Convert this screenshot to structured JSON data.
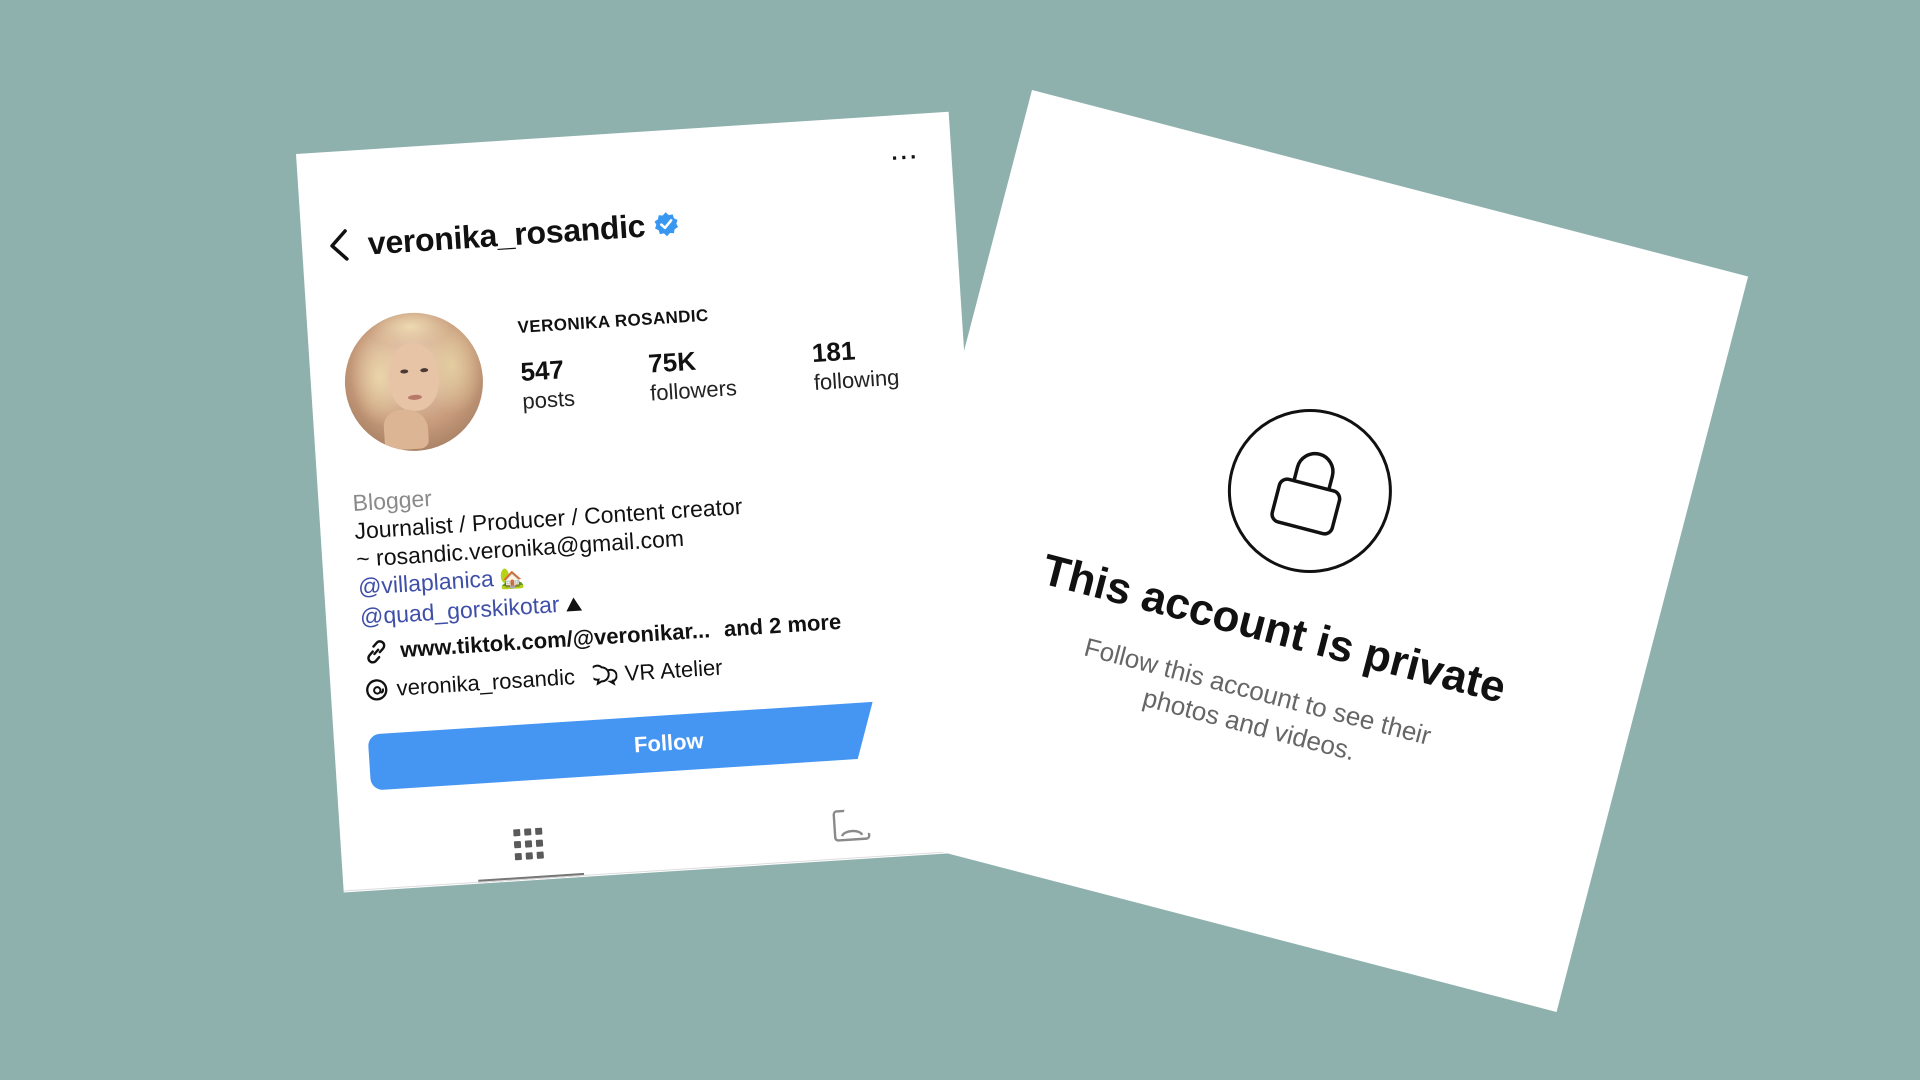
{
  "profile": {
    "username": "veronika_rosandic",
    "display_name": "VERONIKA ROSANDIC",
    "stats": {
      "posts_value": "547",
      "posts_label": "posts",
      "followers_value": "75K",
      "followers_label": "followers",
      "following_value": "181",
      "following_label": "following"
    },
    "bio": {
      "category": "Blogger",
      "line1": "Journalist / Producer / Content creator",
      "line2": "~ rosandic.veronika@gmail.com",
      "mention1": "@villaplanica",
      "mention2": "@quad_gorskikotar",
      "link": "www.tiktok.com/@veronikar...",
      "link_more": "and 2 more",
      "threads_handle": "veronika_rosandic",
      "channel_name": "VR Atelier"
    },
    "follow_label": "Follow",
    "more_label": "···"
  },
  "private": {
    "title": "This account is private",
    "subtitle": "Follow this account to see their photos and videos."
  },
  "colors": {
    "background": "#8fb1ae",
    "follow_button": "#4596f2",
    "verified_badge": "#3897f0",
    "mention": "#3f4fa8"
  },
  "icons": [
    "back-arrow-icon",
    "verified-badge-icon",
    "more-icon",
    "link-icon",
    "threads-icon",
    "channel-icon",
    "grid-icon",
    "tagged-icon",
    "lock-icon"
  ]
}
